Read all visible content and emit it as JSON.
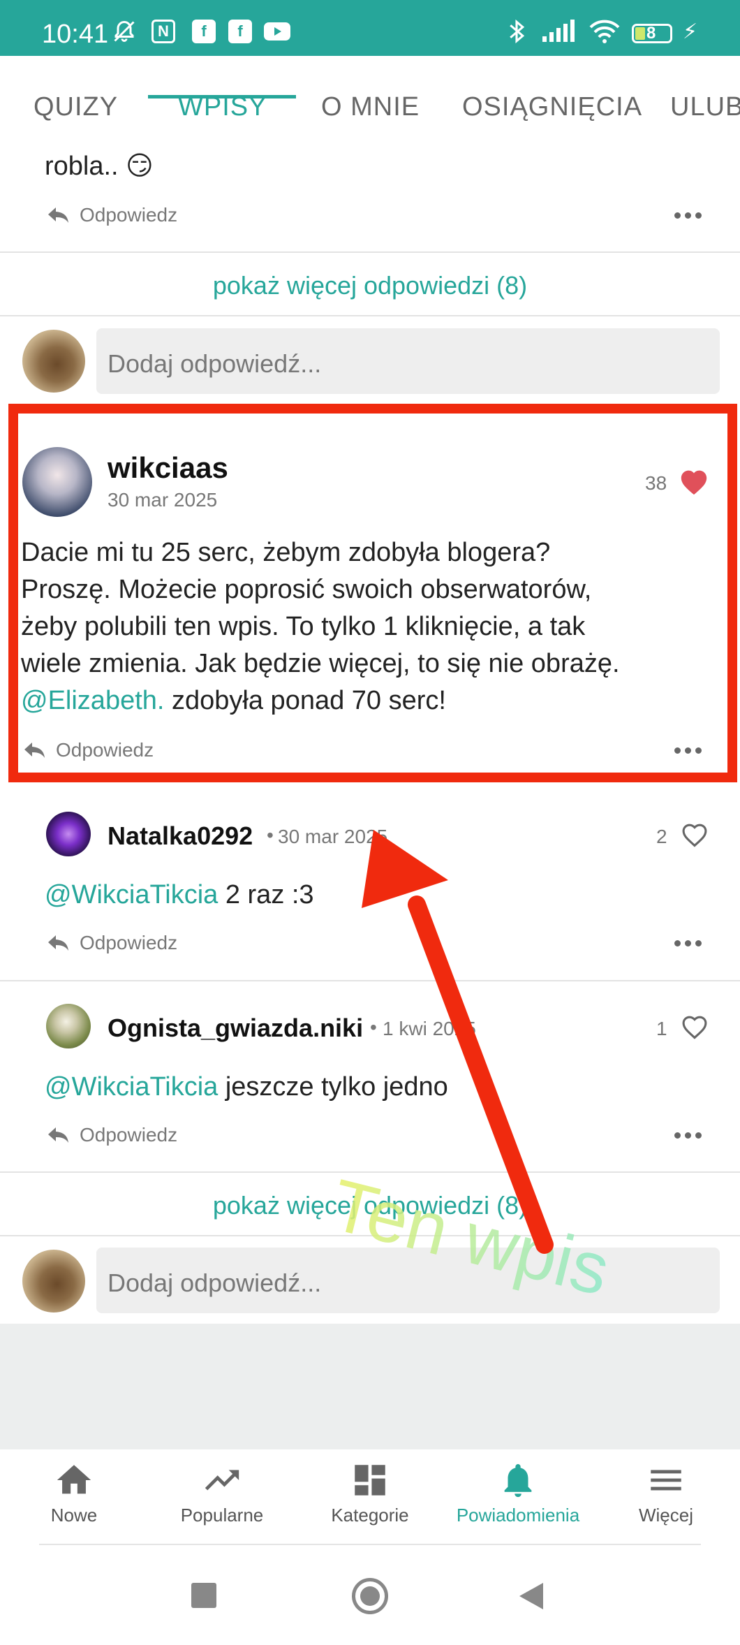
{
  "status_bar": {
    "time": "10:41",
    "battery": "8"
  },
  "tabs": [
    {
      "label": "QUIZY"
    },
    {
      "label": "WPISY"
    },
    {
      "label": "O MNIE"
    },
    {
      "label": "OSIĄGNIĘCIA"
    },
    {
      "label": "ULUB"
    }
  ],
  "prev_comment": {
    "text_tail": "robla.. 😏",
    "reply_label": "Odpowiedz"
  },
  "show_more_top": "pokaż więcej odpowiedzi (8)",
  "reply_input_placeholder": "Dodaj odpowiedź...",
  "main_post": {
    "author": "wikciaas",
    "date": "30 mar 2025",
    "likes": "38",
    "body_lines": [
      "Dacie mi tu 25 serc, żebym zdobyła blogera?",
      "Proszę. Możecie poprosić swoich obserwatorów,",
      "żeby polubili ten wpis. To tylko 1 kliknięcie, a tak",
      "wiele zmienia. Jak będzie więcej, to się nie obrażę."
    ],
    "mention": "@Elizabeth.",
    "last_line_rest": " zdobyła ponad 70 serc!",
    "reply_label": "Odpowiedz"
  },
  "replies": [
    {
      "author": "Natalka0292",
      "date": "30 mar 2025",
      "likes": "2",
      "mention": "@WikciaTikcia",
      "text": " 2 raz :3",
      "reply_label": "Odpowiedz"
    },
    {
      "author": "Ognista_gwiazda.niki",
      "date": "1 kwi 2025",
      "likes": "1",
      "mention": "@WikciaTikcia",
      "text": " jeszcze tylko jedno",
      "reply_label": "Odpowiedz"
    }
  ],
  "show_more_bottom": "pokaż więcej odpowiedzi (8)",
  "annotation": {
    "overlay_text": "Ten wpis",
    "arrow_color": "#f02a0e",
    "box_color": "#f02a0e"
  },
  "bottom_nav": [
    {
      "label": "Nowe",
      "icon": "home-icon"
    },
    {
      "label": "Popularne",
      "icon": "trending-icon"
    },
    {
      "label": "Kategorie",
      "icon": "dashboard-icon"
    },
    {
      "label": "Powiadomienia",
      "icon": "bell-icon"
    },
    {
      "label": "Więcej",
      "icon": "menu-icon"
    }
  ],
  "colors": {
    "accent": "#26a69a",
    "heart": "#e0505a"
  }
}
